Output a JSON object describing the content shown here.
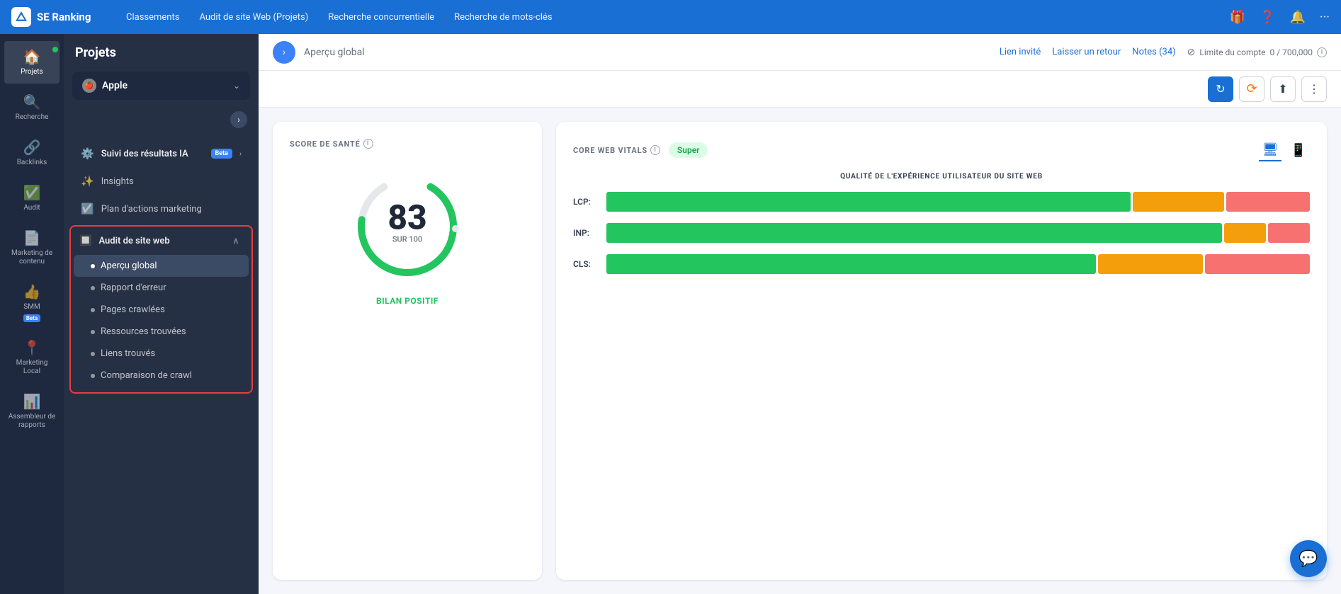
{
  "app": {
    "name": "SE Ranking",
    "logo_alt": "SE Ranking Logo"
  },
  "top_nav": {
    "links": [
      {
        "id": "classements",
        "label": "Classements"
      },
      {
        "id": "audit_site_web",
        "label": "Audit de site Web (Projets)"
      },
      {
        "id": "recherche_concurrentielle",
        "label": "Recherche concurrentielle"
      },
      {
        "id": "recherche_mots_cles",
        "label": "Recherche de mots-clés"
      }
    ]
  },
  "icon_nav": {
    "items": [
      {
        "id": "projets",
        "label": "Projets",
        "icon": "🏠",
        "active": true
      },
      {
        "id": "recherche",
        "label": "Recherche",
        "icon": "🔍",
        "active": false
      },
      {
        "id": "backlinks",
        "label": "Backlinks",
        "icon": "🔗",
        "active": false
      },
      {
        "id": "audit",
        "label": "Audit",
        "icon": "✅",
        "active": false
      },
      {
        "id": "marketing_contenu",
        "label": "Marketing de contenu",
        "icon": "📄",
        "active": false
      },
      {
        "id": "smm",
        "label": "SMM",
        "icon": "👍",
        "active": false,
        "has_beta": true
      },
      {
        "id": "marketing_local",
        "label": "Marketing Local",
        "icon": "📍",
        "active": false
      },
      {
        "id": "assembleur",
        "label": "Assembleur de rapports",
        "icon": "📊",
        "active": false
      }
    ]
  },
  "sidebar": {
    "title": "Projets",
    "project": {
      "name": "Apple",
      "icon": "🍎"
    },
    "menu_items": [
      {
        "id": "suivi_resultats_ia",
        "label": "Suivi des résultats IA",
        "icon": "⚙️",
        "has_beta": true
      },
      {
        "id": "insights",
        "label": "Insights",
        "icon": "✨"
      },
      {
        "id": "plan_actions",
        "label": "Plan d'actions marketing",
        "icon": "☑️"
      }
    ],
    "audit_section": {
      "title": "Audit de site web",
      "icon": "🔲",
      "sub_items": [
        {
          "id": "apercu_global",
          "label": "Aperçu global",
          "active": true
        },
        {
          "id": "rapport_erreur",
          "label": "Rapport d'erreur",
          "active": false
        },
        {
          "id": "pages_crawlees",
          "label": "Pages crawlées",
          "active": false
        },
        {
          "id": "ressources_trouvees",
          "label": "Ressources trouvées",
          "active": false
        },
        {
          "id": "liens_trouves",
          "label": "Liens trouvés",
          "active": false
        },
        {
          "id": "comparaison_crawl",
          "label": "Comparaison de crawl",
          "active": false
        }
      ]
    }
  },
  "content_header": {
    "breadcrumb": "Aperçu global",
    "tab_active": "apercu_global",
    "links": [
      {
        "id": "lien_invite",
        "label": "Lien invité"
      },
      {
        "id": "laisser_retour",
        "label": "Laisser un retour"
      }
    ],
    "notes_label": "Notes (34)",
    "account_limit_label": "Limite du compte",
    "account_limit_value": "0 / 700,000"
  },
  "toolbar": {
    "refresh_btn": "↻",
    "settings_btn": "⚙",
    "upload_btn": "⬆",
    "more_btn": "⋮"
  },
  "score_card": {
    "title": "SCORE DE SANTÉ",
    "info": "i",
    "score": "83",
    "out_of": "SUR 100",
    "status": "BILAN POSITIF",
    "gauge_color": "#22c55e",
    "gauge_bg": "#e5e7eb"
  },
  "cwv_card": {
    "title": "CORE WEB VITALS",
    "info": "i",
    "badge": "Super",
    "quality_title": "QUALITÉ DE L'EXPÉRIENCE UTILISATEUR DU SITE WEB",
    "device_desktop": "🖥",
    "device_mobile": "📱",
    "metrics": [
      {
        "label": "LCP:",
        "bars": [
          {
            "type": "green",
            "width_pct": 75
          },
          {
            "type": "yellow",
            "width_pct": 13
          },
          {
            "type": "red",
            "width_pct": 12
          }
        ]
      },
      {
        "label": "INP:",
        "bars": [
          {
            "type": "green",
            "width_pct": 88
          },
          {
            "type": "yellow",
            "width_pct": 6
          },
          {
            "type": "red",
            "width_pct": 6
          }
        ]
      },
      {
        "label": "CLS:",
        "bars": [
          {
            "type": "green",
            "width_pct": 70
          },
          {
            "type": "yellow",
            "width_pct": 15
          },
          {
            "type": "red",
            "width_pct": 15
          }
        ]
      }
    ]
  }
}
